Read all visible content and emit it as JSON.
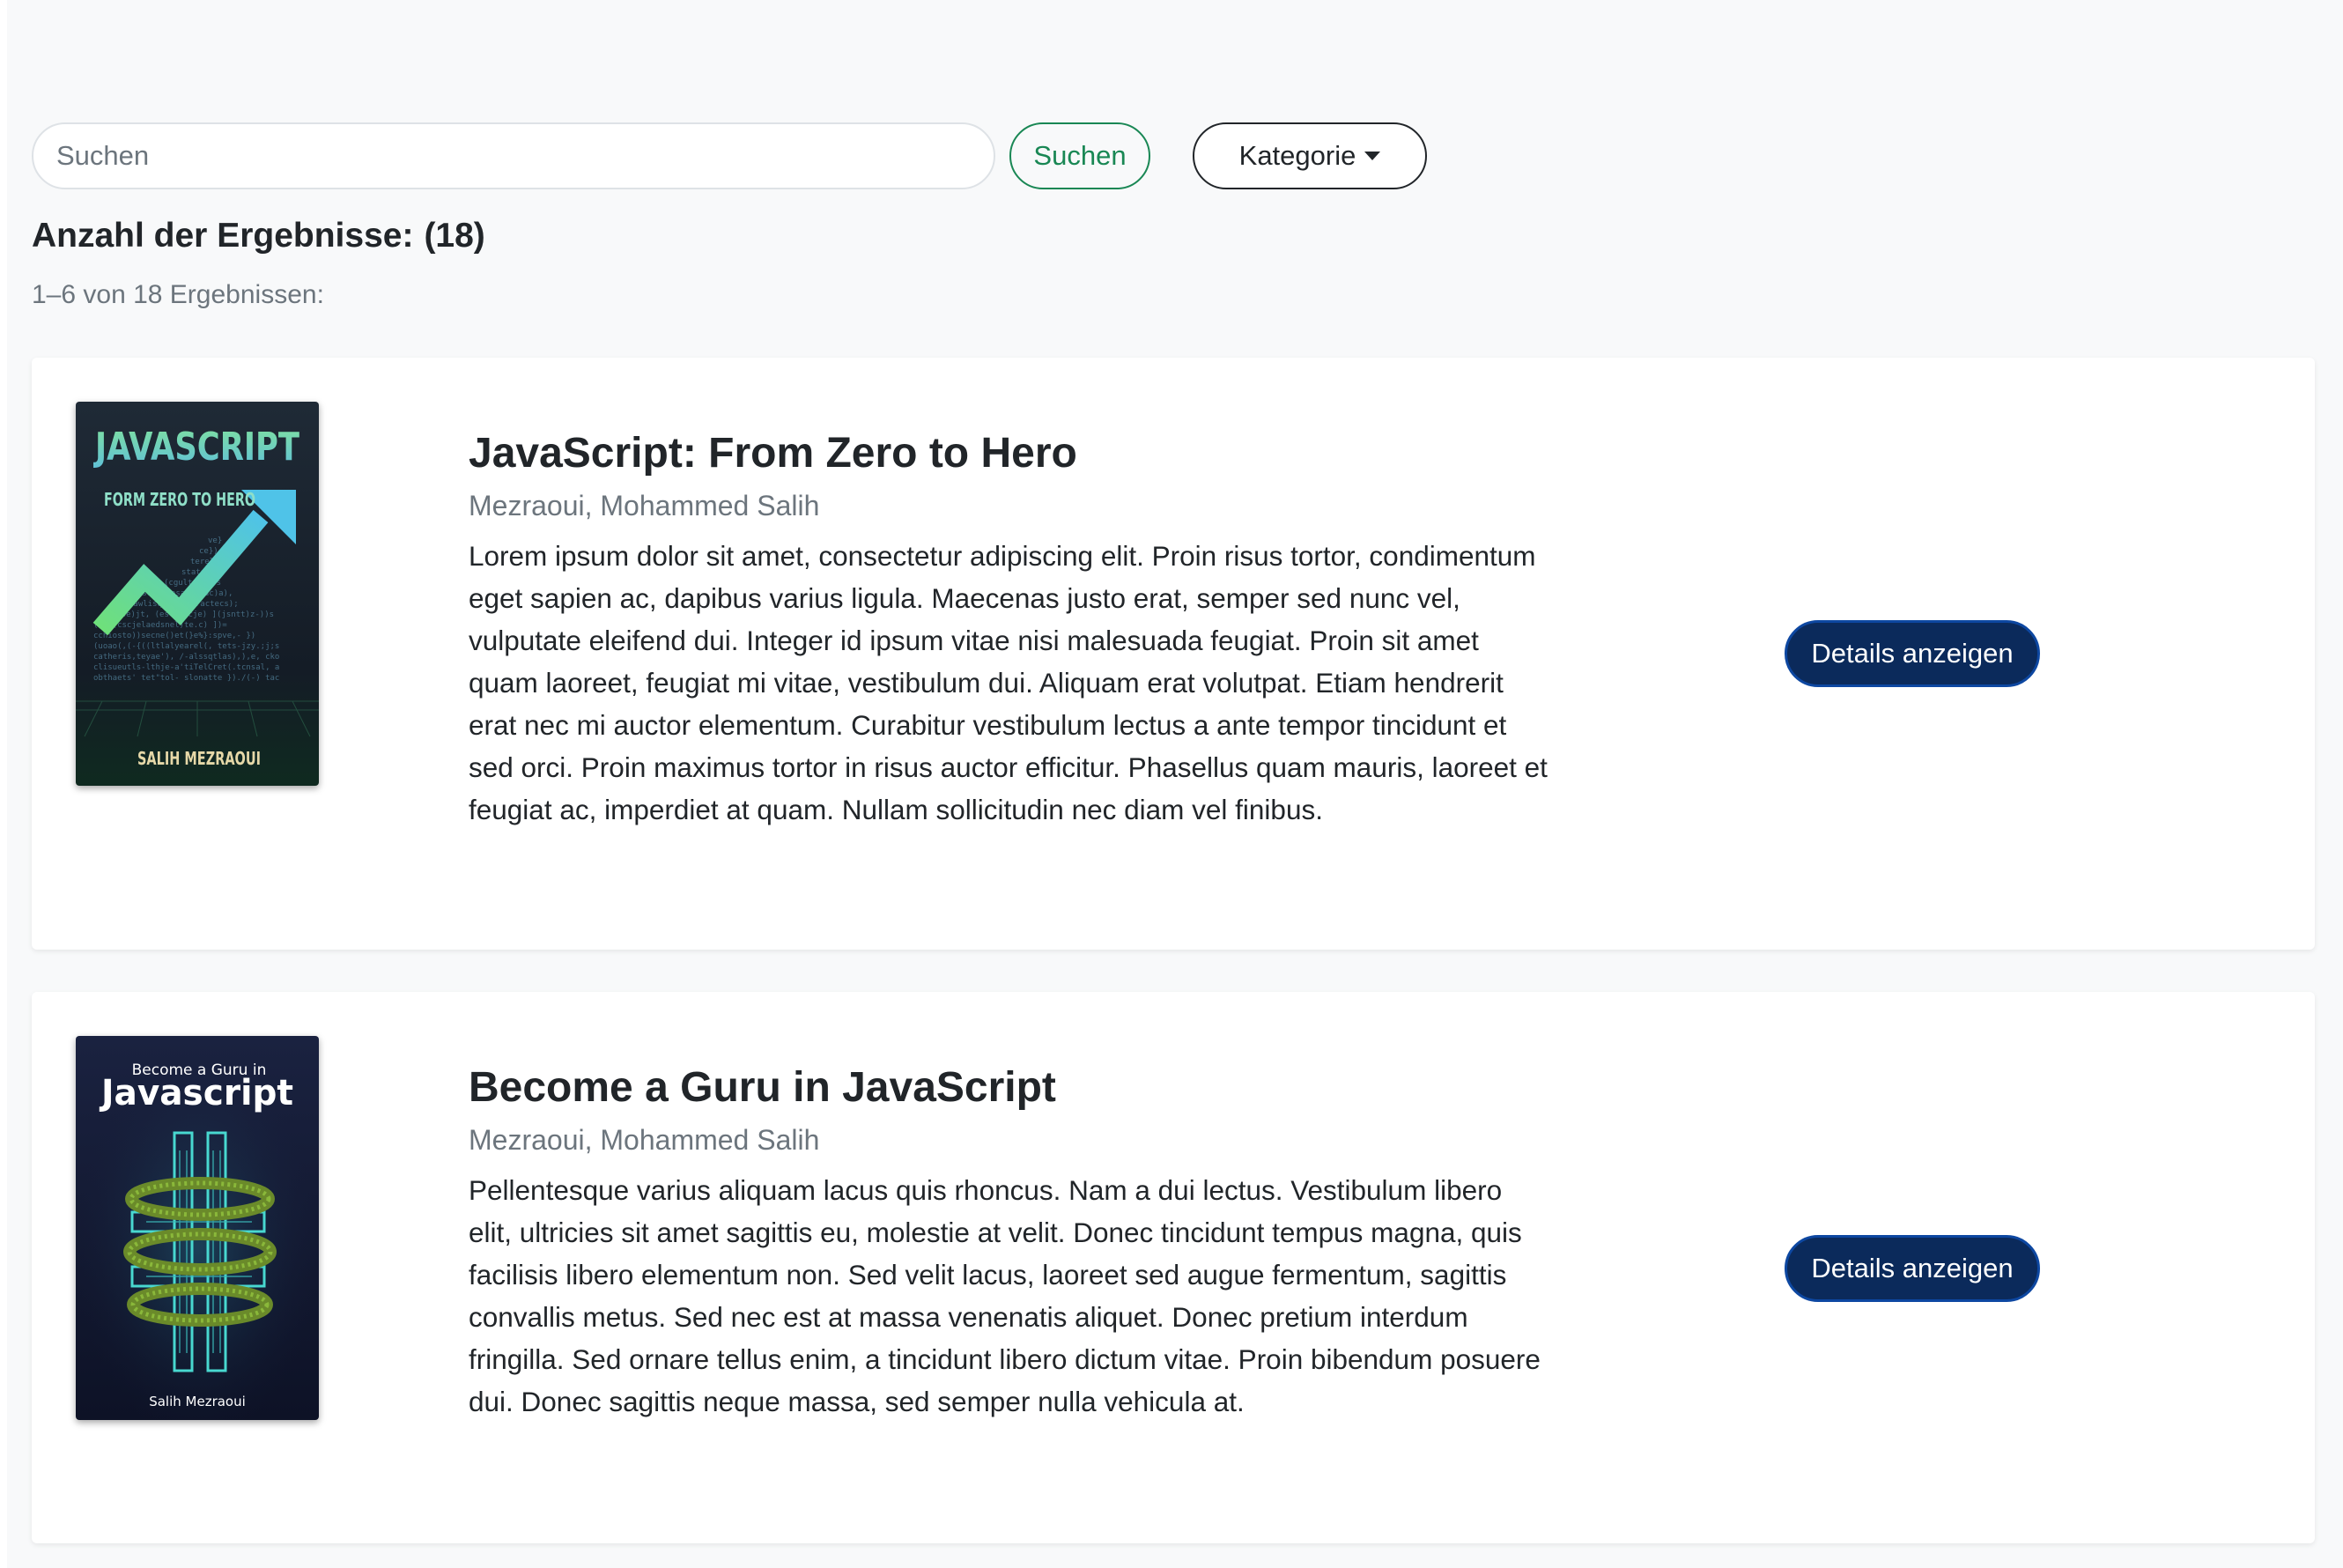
{
  "search": {
    "placeholder": "Suchen",
    "button_label": "Suchen",
    "category_label": "Kategorie"
  },
  "results": {
    "count_label": "Anzahl der Ergebnisse:",
    "count_value": "(18)",
    "range_text": "1–6 von 18 Ergebnissen:"
  },
  "books": [
    {
      "title": "JavaScript: From Zero to Hero",
      "author": "Mezraoui, Mohammed Salih",
      "description": "Lorem ipsum dolor sit amet, consectetur adipiscing elit. Proin risus tortor, condimentum eget sapien ac, dapibus varius ligula. Maecenas justo erat, semper sed nunc vel, vulputate eleifend dui. Integer id ipsum vitae nisi malesuada feugiat. Proin sit amet quam laoreet, feugiat mi vitae, vestibulum dui. Aliquam erat volutpat. Etiam hendrerit erat nec mi auctor elementum. Curabitur vestibulum lectus a ante tempor tincidunt et sed orci. Proin maximus tortor in risus auctor efficitur. Phasellus quam mauris, laoreet et feugiat ac, imperdiet at quam. Nullam sollicitudin nec diam vel finibus.",
      "button_label": "Details anzeigen",
      "cover": {
        "title": "JAVASCRIPT",
        "subtitle": "FORM ZERO TO HERO",
        "author": "SALIH MEZRAOUI"
      }
    },
    {
      "title": "Become a Guru in JavaScript",
      "author": "Mezraoui, Mohammed Salih",
      "description": "Pellentesque varius aliquam lacus quis rhoncus. Nam a dui lectus. Vestibulum libero elit, ultricies sit amet sagittis eu, molestie at velit. Donec tincidunt tempus magna, quis facilisis libero elementum non. Sed velit lacus, laoreet sed augue fermentum, sagittis convallis metus. Sed nec est at massa venenatis aliquet. Donec pretium interdum fringilla. Sed ornare tellus enim, a tincidunt libero dictum vitae. Proin bibendum posuere dui. Donec sagittis neque massa, sed semper nulla vehicula at.",
      "button_label": "Details anzeigen",
      "cover": {
        "pretitle": "Become a Guru in",
        "title": "Javascript",
        "author": "Salih Mezraoui"
      }
    }
  ]
}
